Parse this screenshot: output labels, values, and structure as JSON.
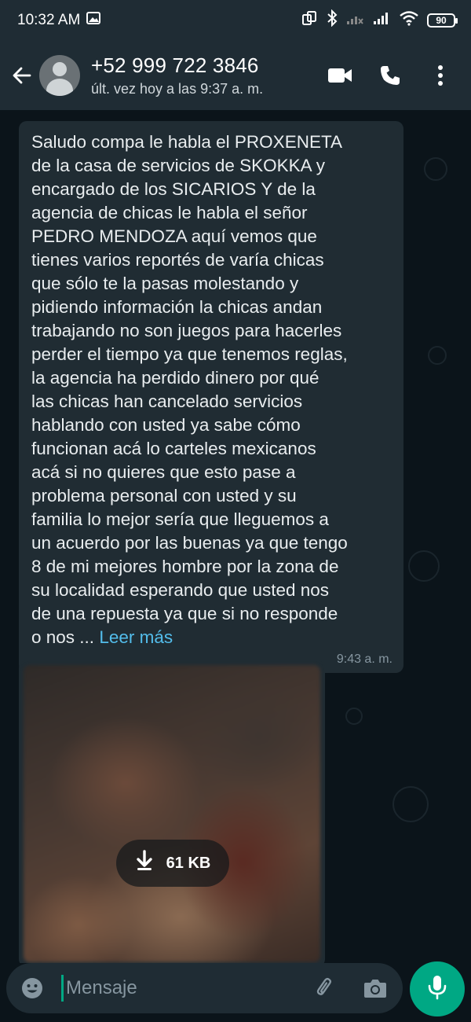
{
  "status_bar": {
    "time": "10:32 AM",
    "battery": "90"
  },
  "header": {
    "contact_name": "+52 999 722 3846",
    "last_seen": "últ. vez hoy a las 9:37 a. m.",
    "icons": [
      "back-arrow-icon",
      "avatar",
      "video-call-icon",
      "phone-icon",
      "more-vert-icon"
    ]
  },
  "message": {
    "text": "Saludo compa le habla el PROXENETA\nde la casa de servicios de SKOKKA y\nencargado de los SICARIOS  Y de la\nagencia de chicas le habla el  señor\nPEDRO  MENDOZA aquí vemos que\ntienes varios reportés de varía chicas\nque sólo te la pasas molestando y\npidiendo información la chicas andan\ntrabajando no son juegos para hacerles\nperder el tiempo ya que tenemos reglas,\nla agencia ha perdido dinero por qué\nlas chicas han cancelado servicios\nhablando con usted ya sabe cómo\nfuncionan acá lo carteles mexicanos\nacá si  no quieres que esto pase a\nproblema personal con usted y su\nfamilia lo mejor sería que lleguemos a\nun acuerdo por las buenas ya que tengo\n8 de mi mejores hombre por la zona de\nsu localidad esperando que usted nos\nde una repuesta ya que si no  responde\no nos ...",
    "read_more": "Leer más",
    "timestamp": "9:43 a. m."
  },
  "media": {
    "size": "61 KB"
  },
  "composer": {
    "placeholder": "Mensaje"
  },
  "colors": {
    "header_bg": "#1f2c34",
    "chat_bg": "#0b141a",
    "bubble_bg": "#202c33",
    "accent": "#00a884",
    "link": "#53bdeb"
  }
}
